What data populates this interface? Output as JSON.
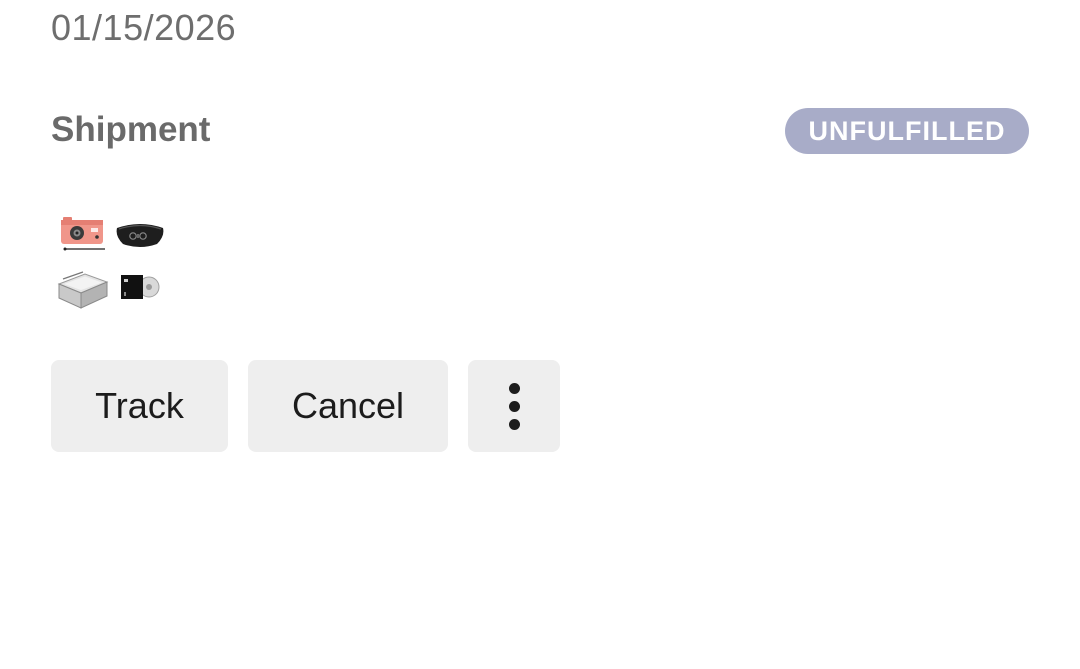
{
  "order": {
    "date": "01/15/2026"
  },
  "shipment": {
    "title": "Shipment",
    "status": "UNFULFILLED",
    "status_color": "#a8acc8",
    "items": [
      {
        "icon": "camera-icon"
      },
      {
        "icon": "waist-bag-icon"
      },
      {
        "icon": "box-icon"
      },
      {
        "icon": "vinyl-record-icon"
      }
    ]
  },
  "actions": {
    "track_label": "Track",
    "cancel_label": "Cancel",
    "more_icon": "more-vertical-icon"
  }
}
